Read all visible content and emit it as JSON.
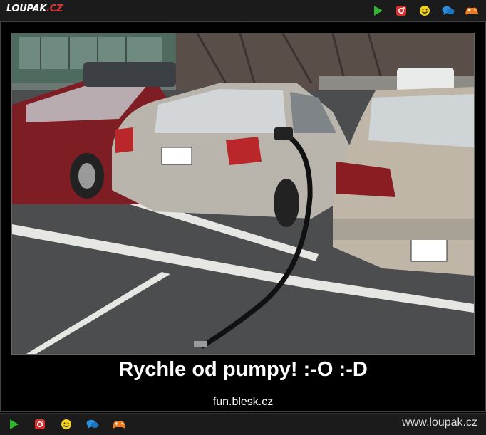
{
  "header": {
    "logo_text": "LOUPAK",
    "logo_suffix": ".CZ",
    "icons": [
      "play-icon",
      "instagram-icon",
      "smiley-icon",
      "chat-icon",
      "gamepad-icon"
    ]
  },
  "post": {
    "caption": "Rychle od pumpy! :-O :-D",
    "source": "fun.blesk.cz"
  },
  "footer": {
    "site": "www.loupak.cz",
    "icons": [
      "play-icon",
      "instagram-icon",
      "smiley-icon",
      "chat-icon",
      "gamepad-icon"
    ]
  },
  "colors": {
    "bar_bg": "#1b1b1b",
    "play": "#2fb52f",
    "instagram": "#d9302f",
    "smiley": "#f2d21a",
    "chat": "#2a8ee0",
    "gamepad": "#f07a1a"
  }
}
